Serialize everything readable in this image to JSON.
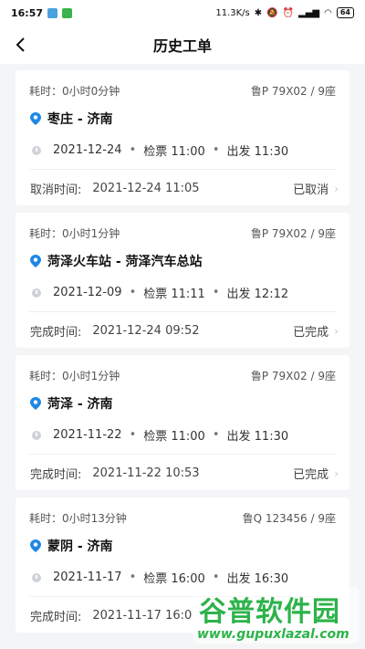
{
  "status_bar": {
    "time": "16:57",
    "speed": "11.3K/s",
    "battery": "64"
  },
  "header": {
    "title": "历史工单"
  },
  "orders": [
    {
      "duration": "耗时：0小时0分钟",
      "vehicle": "鲁P 79X02 / 9座",
      "route": "枣庄 - 济南",
      "date": "2021-12-24",
      "check_in": "检票 11:00",
      "depart": "出发 11:30",
      "footer_label": "取消时间:",
      "footer_time": "2021-12-24 11:05",
      "status": "已取消"
    },
    {
      "duration": "耗时：0小时1分钟",
      "vehicle": "鲁P 79X02 / 9座",
      "route": "菏泽火车站 - 菏泽汽车总站",
      "date": "2021-12-09",
      "check_in": "检票 11:11",
      "depart": "出发 12:12",
      "footer_label": "完成时间:",
      "footer_time": "2021-12-24 09:52",
      "status": "已完成"
    },
    {
      "duration": "耗时：0小时1分钟",
      "vehicle": "鲁P 79X02 / 9座",
      "route": "菏泽 - 济南",
      "date": "2021-11-22",
      "check_in": "检票 11:00",
      "depart": "出发 11:30",
      "footer_label": "完成时间:",
      "footer_time": "2021-11-22 10:53",
      "status": "已完成"
    },
    {
      "duration": "耗时：0小时13分钟",
      "vehicle": "鲁Q 123456 / 9座",
      "route": "蒙阴 - 济南",
      "date": "2021-11-17",
      "check_in": "检票 16:00",
      "depart": "出发 16:30",
      "footer_label": "完成时间:",
      "footer_time": "2021-11-17 16:0",
      "status": ""
    }
  ],
  "watermark": {
    "name": "谷普软件园",
    "url": "www.gupuxlazal.com"
  },
  "colors": {
    "pin": "#1e88e5",
    "watermark": "#2db34a"
  },
  "icons": {
    "back": "chevron-left-icon",
    "pin": "location-pin-icon",
    "clock": "clock-icon",
    "chevron": "chevron-right-icon"
  }
}
